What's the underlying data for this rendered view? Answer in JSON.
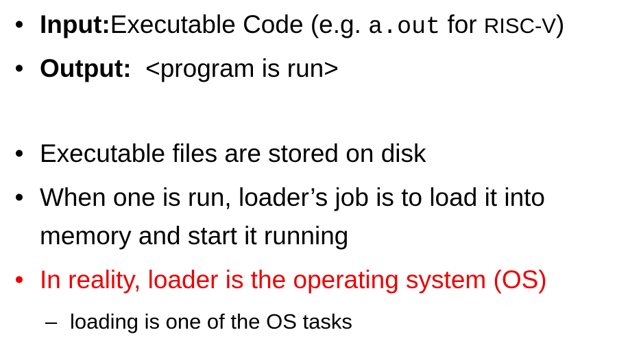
{
  "colors": {
    "text": "#000000",
    "highlight": "#ee0000"
  },
  "bullets": {
    "symbol": "•",
    "input": {
      "label": "Input:",
      "text_before": "Executable Code (e.g. ",
      "code": "a.out",
      "text_middle": " for ",
      "arch": "RISC-V",
      "text_after": ")"
    },
    "output": {
      "label": "Output:",
      "text": "  <program is run>"
    },
    "stored": "Executable files are stored on disk",
    "loader_job_line1": "When one is run, loader’s job is to load it into",
    "loader_job_line2": "memory and start it running",
    "reality": "In reality, loader is the operating system (OS)",
    "sub": {
      "dash": "–",
      "text": "loading is one of the OS tasks"
    }
  }
}
